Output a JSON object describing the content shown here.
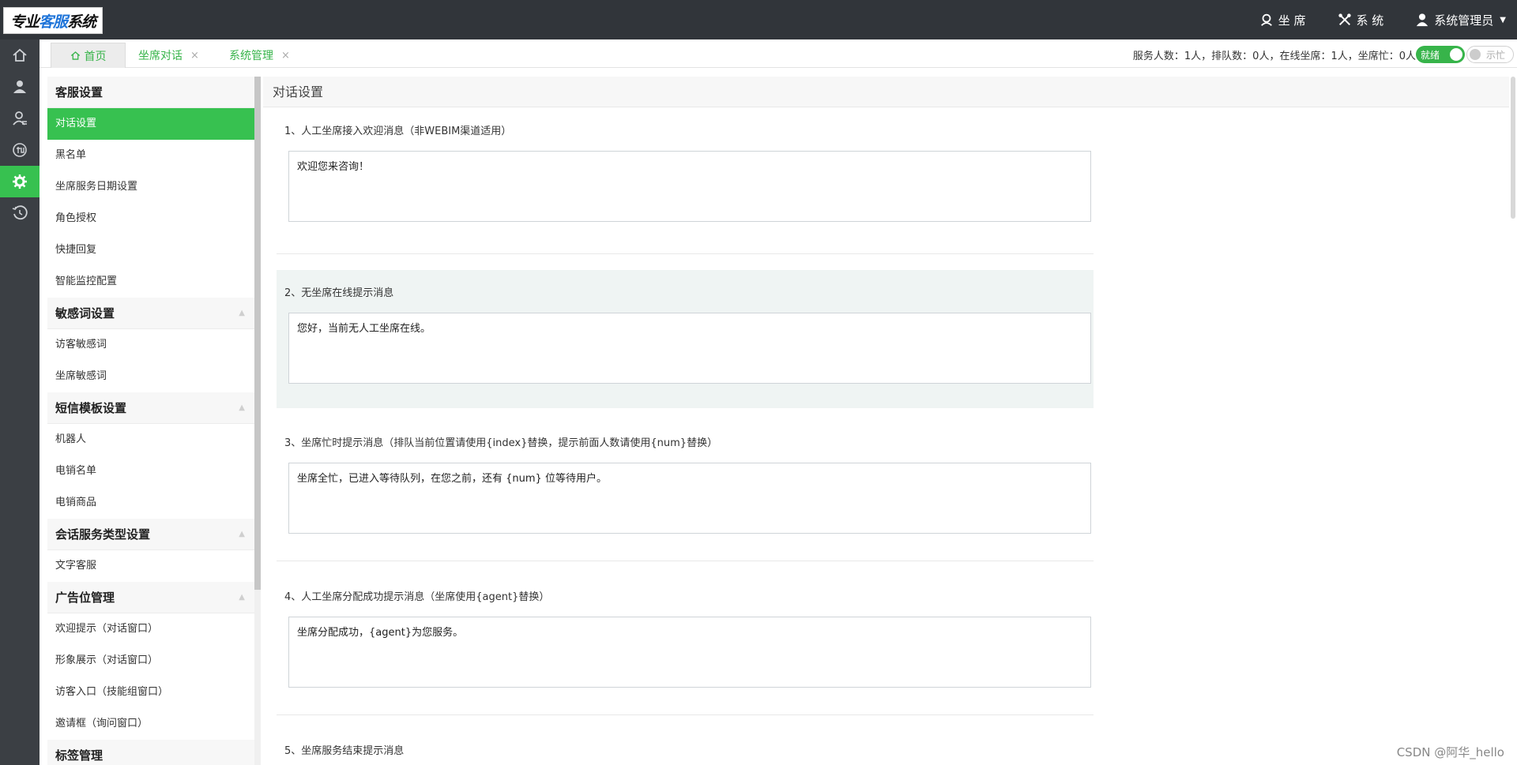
{
  "app": {
    "logo_pre": "专业",
    "logo_hl": "客服",
    "logo_post": "系统"
  },
  "topbar": {
    "agent_label": "坐 席",
    "system_label": "系 统",
    "user_label": "系统管理员"
  },
  "tabs": {
    "home": "首页",
    "tab1": "坐席对话",
    "tab2": "系统管理",
    "close_glyph": "×"
  },
  "status": {
    "text": "服务人数：1人，排队数：0人，在线坐席：1人，坐席忙：0人",
    "ready_label": "就绪",
    "busy_label": "示忙"
  },
  "menu": {
    "groups": [
      {
        "title": "客服设置",
        "items": [
          "对话设置",
          "黑名单",
          "坐席服务日期设置",
          "角色授权",
          "快捷回复",
          "智能监控配置"
        ]
      },
      {
        "title": "敏感词设置",
        "items": [
          "访客敏感词",
          "坐席敏感词"
        ]
      },
      {
        "title": "短信模板设置",
        "items": [
          "机器人",
          "电销名单",
          "电销商品"
        ]
      },
      {
        "title": "会话服务类型设置",
        "items": [
          "文字客服"
        ]
      },
      {
        "title": "广告位管理",
        "items": [
          "欢迎提示（对话窗口）",
          "形象展示（对话窗口）",
          "访客入口（技能组窗口）",
          "邀请框（询问窗口）"
        ]
      },
      {
        "title": "标签管理",
        "items": []
      }
    ]
  },
  "content": {
    "title": "对话设置",
    "sections": [
      {
        "label": "1、人工坐席接入欢迎消息（非WEBIM渠道适用）",
        "value": "欢迎您来咨询！"
      },
      {
        "label": "2、无坐席在线提示消息",
        "value": "您好，当前无人工坐席在线。"
      },
      {
        "label": "3、坐席忙时提示消息（排队当前位置请使用{index}替换，提示前面人数请使用{num}替换）",
        "value": "坐席全忙，已进入等待队列，在您之前，还有 {num} 位等待用户。"
      },
      {
        "label": "4、人工坐席分配成功提示消息（坐席使用{agent}替换）",
        "value": "坐席分配成功，{agent}为您服务。"
      },
      {
        "label": "5、坐席服务结束提示消息",
        "value": ""
      }
    ]
  },
  "watermark": "CSDN @阿华_hello",
  "colors": {
    "accent": "#37c150",
    "topbar": "#31353a",
    "rail": "#3b3f44"
  }
}
